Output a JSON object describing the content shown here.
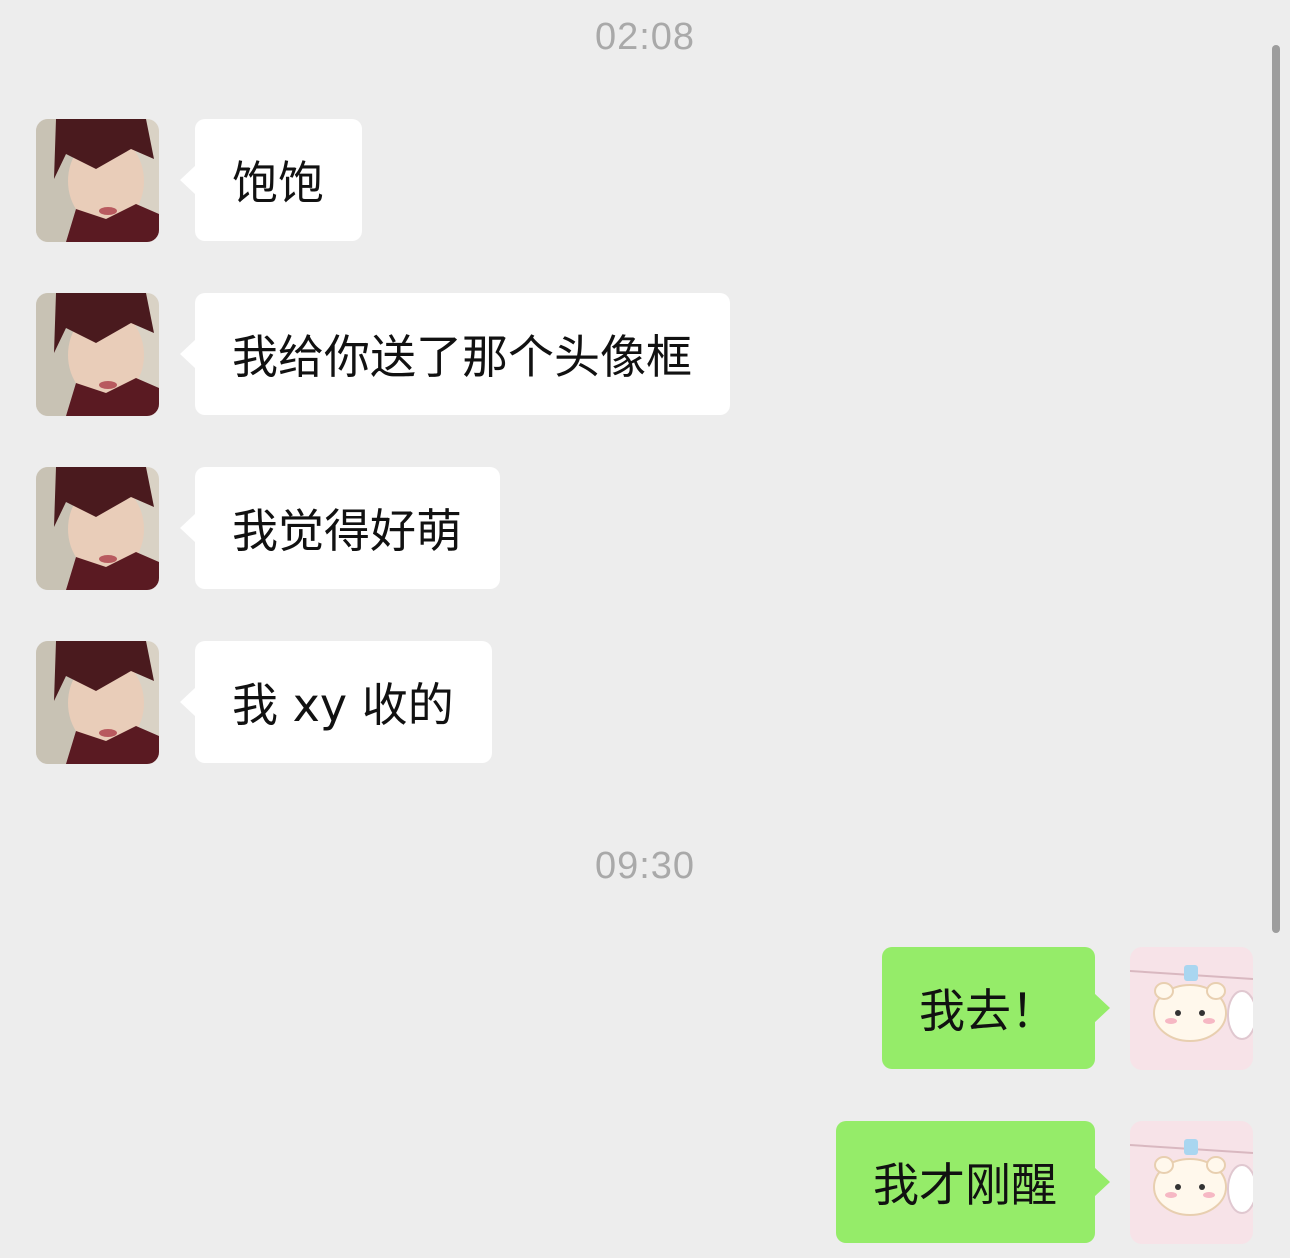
{
  "chat": {
    "timestamp_1": "02:08",
    "timestamp_2": "09:30",
    "incoming": [
      {
        "text": "饱饱"
      },
      {
        "text": "我给你送了那个头像框"
      },
      {
        "text": "我觉得好萌"
      },
      {
        "text": "我 xy 收的"
      }
    ],
    "outgoing": [
      {
        "text": "我去！"
      },
      {
        "text": "我才刚醒"
      }
    ]
  },
  "icons": {
    "contact_avatar": "person-photo-avatar-icon",
    "self_avatar": "cartoon-hamster-avatar-icon"
  },
  "colors": {
    "background": "#ededed",
    "incoming_bubble": "#ffffff",
    "outgoing_bubble": "#95ec69",
    "timestamp_text": "#a9a9a9",
    "message_text": "#111111"
  }
}
